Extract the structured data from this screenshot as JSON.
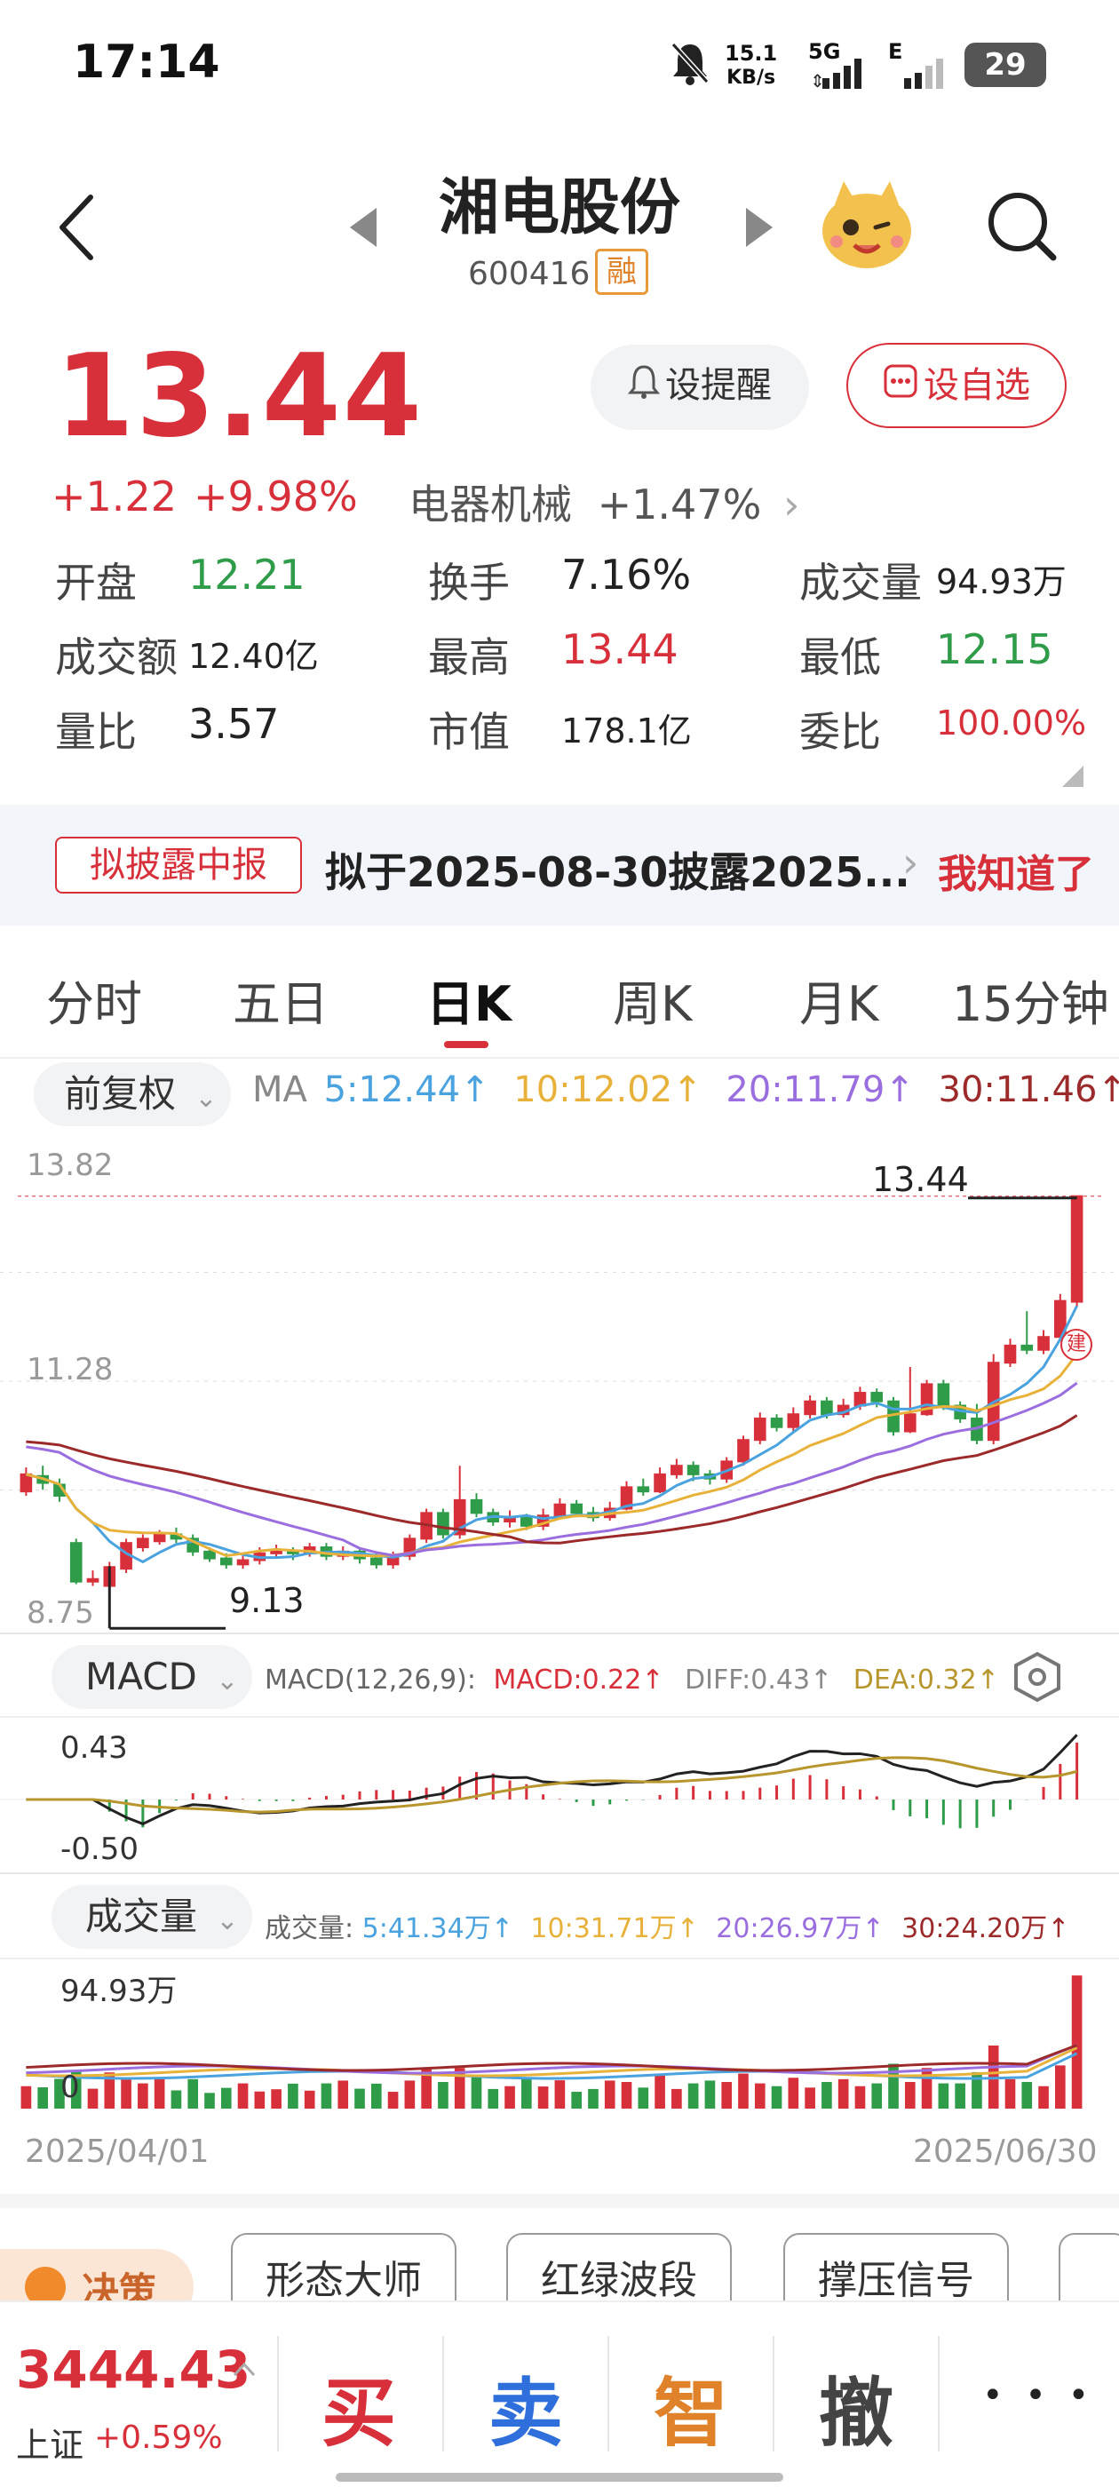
{
  "status_bar": {
    "time": "17:14",
    "net_speed_value": "15.1",
    "net_speed_unit": "KB/s",
    "network": "5G",
    "network2": "E",
    "battery": "29"
  },
  "header": {
    "title": "湘电股份",
    "code": "600416",
    "margin_badge": "融"
  },
  "quote": {
    "price": "13.44",
    "change": "+1.22",
    "change_pct": "+9.98%",
    "sector": "电器机械",
    "sector_change": "+1.47%",
    "remind_label": "设提醒",
    "watch_label": "设自选"
  },
  "stats": [
    {
      "label": "开盘",
      "value": "12.21",
      "color": "green"
    },
    {
      "label": "换手",
      "value": "7.16%",
      "color": "black"
    },
    {
      "label": "成交量",
      "value": "94.93万",
      "color": "black"
    },
    {
      "label": "成交额",
      "value": "12.40亿",
      "color": "black"
    },
    {
      "label": "最高",
      "value": "13.44",
      "color": "red"
    },
    {
      "label": "最低",
      "value": "12.15",
      "color": "green"
    },
    {
      "label": "量比",
      "value": "3.57",
      "color": "black"
    },
    {
      "label": "市值",
      "value": "178.1亿",
      "color": "black"
    },
    {
      "label": "委比",
      "value": "100.00%",
      "color": "red"
    }
  ],
  "banner": {
    "tag": "拟披露中报",
    "text": "拟于2025-08-30披露2025...",
    "ack": "我知道了"
  },
  "tabs": [
    "分时",
    "五日",
    "日K",
    "周K",
    "月K",
    "15分钟"
  ],
  "active_tab": "日K",
  "kline": {
    "adjust": "前复权",
    "ma_label": "MA",
    "ma5": "5:12.44↑",
    "ma10": "10:12.02↑",
    "ma20": "20:11.79↑",
    "ma30": "30:11.46↑",
    "axis_top": "13.82",
    "axis_mid": "11.28",
    "axis_bottom": "8.75",
    "high_mark": "13.44",
    "low_mark": "9.13",
    "build_mark": "建"
  },
  "macd": {
    "name": "MACD",
    "params": "MACD(12,26,9):",
    "macd_value": "MACD:0.22↑",
    "diff_value": "DIFF:0.43↑",
    "dea_value": "DEA:0.32↑",
    "axis_top": "0.43",
    "axis_bottom": "-0.50"
  },
  "volume": {
    "name": "成交量",
    "prefix": "成交量:",
    "ma5": "5:41.34万↑",
    "ma10": "10:31.71万↑",
    "ma20": "20:26.97万↑",
    "ma30": "30:24.20万↑",
    "axis_top": "94.93万",
    "axis_zero": "0"
  },
  "date_range": {
    "start": "2025/04/01",
    "end": "2025/06/30"
  },
  "bottom_pills": [
    "决策",
    "形态大师",
    "红绿波段",
    "撑压信号"
  ],
  "bottom_bar": {
    "index_value": "3444.43",
    "index_name": "上证",
    "index_change": "+0.59%",
    "buy": "买",
    "sell": "卖",
    "smart": "智",
    "cancel": "撤",
    "more": "• • •"
  },
  "colors": {
    "up": "#d8303a",
    "down": "#2f9c4a",
    "ma5": "#4aa3df",
    "ma10": "#e8b23a",
    "ma20": "#9b6ee0",
    "ma30": "#9c2a2a"
  },
  "chart_data": {
    "type": "candlestick",
    "x_start": "2025/04/01",
    "x_end": "2025/06/30",
    "candles": [
      [
        10.0,
        10.2,
        10.28,
        9.95
      ],
      [
        10.18,
        10.1,
        10.3,
        10.02
      ],
      [
        10.08,
        9.95,
        10.15,
        9.88
      ],
      [
        9.4,
        8.95,
        9.45,
        8.92
      ],
      [
        8.95,
        8.98,
        9.08,
        8.9
      ],
      [
        8.9,
        9.12,
        9.18,
        9.13
      ],
      [
        9.1,
        9.4,
        9.45,
        9.05
      ],
      [
        9.35,
        9.45,
        9.5,
        9.3
      ],
      [
        9.42,
        9.5,
        9.55,
        9.38
      ],
      [
        9.5,
        9.45,
        9.58,
        9.4
      ],
      [
        9.45,
        9.3,
        9.5,
        9.25
      ],
      [
        9.3,
        9.22,
        9.35,
        9.18
      ],
      [
        9.22,
        9.15,
        9.28,
        9.1
      ],
      [
        9.15,
        9.2,
        9.25,
        9.1
      ],
      [
        9.2,
        9.28,
        9.35,
        9.15
      ],
      [
        9.28,
        9.3,
        9.38,
        9.22
      ],
      [
        9.3,
        9.28,
        9.35,
        9.2
      ],
      [
        9.28,
        9.35,
        9.4,
        9.24
      ],
      [
        9.35,
        9.25,
        9.4,
        9.2
      ],
      [
        9.25,
        9.3,
        9.36,
        9.2
      ],
      [
        9.3,
        9.22,
        9.34,
        9.16
      ],
      [
        9.22,
        9.15,
        9.28,
        9.1
      ],
      [
        9.15,
        9.25,
        9.3,
        9.1
      ],
      [
        9.25,
        9.45,
        9.5,
        9.2
      ],
      [
        9.45,
        9.75,
        9.8,
        9.4
      ],
      [
        9.75,
        9.5,
        9.8,
        9.45
      ],
      [
        9.5,
        9.9,
        10.3,
        9.45
      ],
      [
        9.9,
        9.75,
        9.98,
        9.7
      ],
      [
        9.75,
        9.65,
        9.8,
        9.6
      ],
      [
        9.65,
        9.7,
        9.78,
        9.58
      ],
      [
        9.7,
        9.6,
        9.74,
        9.55
      ],
      [
        9.6,
        9.72,
        9.8,
        9.55
      ],
      [
        9.72,
        9.85,
        9.92,
        9.68
      ],
      [
        9.85,
        9.75,
        9.9,
        9.7
      ],
      [
        9.75,
        9.7,
        9.82,
        9.65
      ],
      [
        9.7,
        9.8,
        9.88,
        9.66
      ],
      [
        9.8,
        10.05,
        10.12,
        9.78
      ],
      [
        10.05,
        10.0,
        10.15,
        9.95
      ],
      [
        10.0,
        10.2,
        10.28,
        9.98
      ],
      [
        10.2,
        10.3,
        10.38,
        10.15
      ],
      [
        10.3,
        10.2,
        10.35,
        10.12
      ],
      [
        10.2,
        10.15,
        10.25,
        10.08
      ],
      [
        10.15,
        10.35,
        10.4,
        10.1
      ],
      [
        10.35,
        10.6,
        10.65,
        10.3
      ],
      [
        10.6,
        10.85,
        10.92,
        10.55
      ],
      [
        10.85,
        10.75,
        10.9,
        10.7
      ],
      [
        10.75,
        10.9,
        10.98,
        10.7
      ],
      [
        10.9,
        11.05,
        11.12,
        10.85
      ],
      [
        11.05,
        10.9,
        11.1,
        10.85
      ],
      [
        10.9,
        11.0,
        11.08,
        10.86
      ],
      [
        11.0,
        11.15,
        11.22,
        10.95
      ],
      [
        11.15,
        11.05,
        11.2,
        10.98
      ],
      [
        11.05,
        10.7,
        11.1,
        10.65
      ],
      [
        10.7,
        10.9,
        11.45,
        10.68
      ],
      [
        10.9,
        11.25,
        11.3,
        10.88
      ],
      [
        11.25,
        11.0,
        11.3,
        10.95
      ],
      [
        11.0,
        10.85,
        11.05,
        10.8
      ],
      [
        10.85,
        10.6,
        11.02,
        10.55
      ],
      [
        10.6,
        11.5,
        11.6,
        10.55
      ],
      [
        11.5,
        11.7,
        11.78,
        11.45
      ],
      [
        11.7,
        11.65,
        12.1,
        11.6
      ],
      [
        11.65,
        11.8,
        11.88,
        11.6
      ],
      [
        11.8,
        12.22,
        12.3,
        11.78
      ],
      [
        12.21,
        13.44,
        13.44,
        12.15
      ]
    ],
    "ma_lines": [
      "MA5",
      "MA10",
      "MA20",
      "MA30"
    ],
    "ylim": [
      8.75,
      13.82
    ]
  }
}
